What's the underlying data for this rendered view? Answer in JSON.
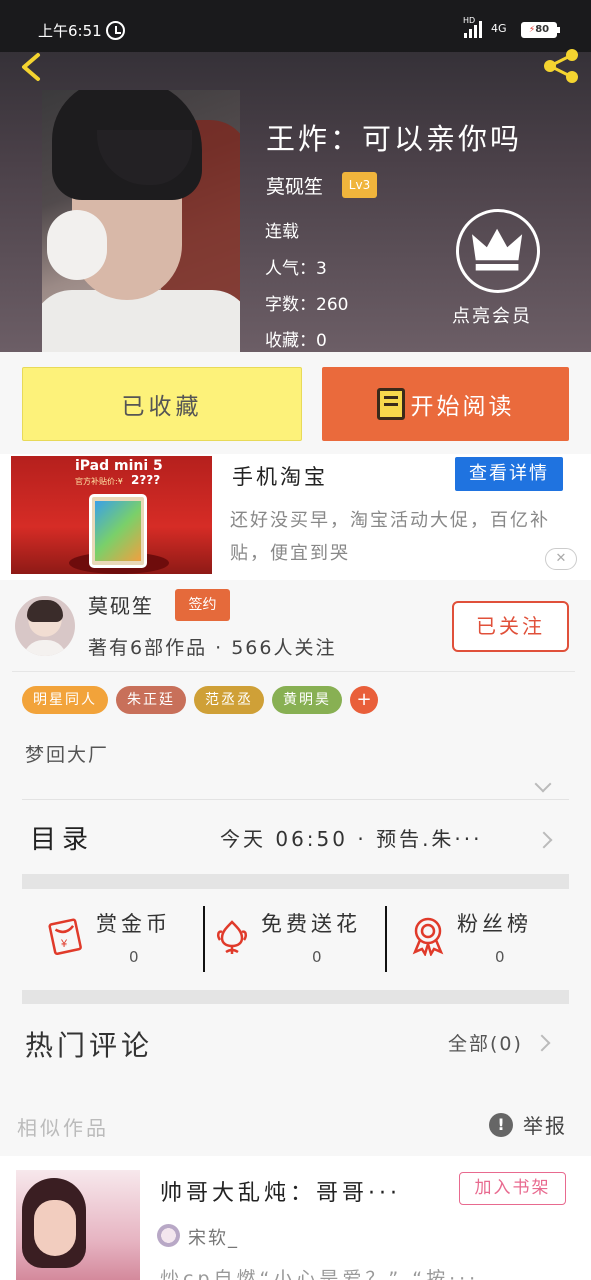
{
  "status_bar": {
    "time": "上午6:51",
    "network": "4G",
    "hd": "HD",
    "battery": "80"
  },
  "book": {
    "title": "王炸：可以亲你吗",
    "author": "莫砚笙",
    "level": "Lv3",
    "status": "连载",
    "popularity": "人气：3",
    "word_count": "字数：260",
    "favorites": "收藏：0",
    "vip_label": "点亮会员"
  },
  "actions": {
    "collected_label": "已收藏",
    "read_label": "开始阅读"
  },
  "ad": {
    "image_title": "iPad mini 5",
    "image_subtitle": "官方补贴价:¥",
    "image_price": "2???",
    "title": "手机淘宝",
    "detail_button": "查看详情",
    "description": "还好没买早，淘宝活动大促，百亿补贴，便宜到哭",
    "close_icon": "✕"
  },
  "author_card": {
    "name": "莫砚笙",
    "badge": "签约",
    "stats": "著有6部作品 · 566人关注",
    "follow_label": "已关注"
  },
  "tags": [
    {
      "label": "明星同人",
      "color": "#f2a33a"
    },
    {
      "label": "朱正廷",
      "color": "#c8705a"
    },
    {
      "label": "范丞丞",
      "color": "#cfa037"
    },
    {
      "label": "黄明昊",
      "color": "#88b053"
    }
  ],
  "tag_add": "+",
  "intro": "梦回大厂",
  "toc": {
    "title": "目录",
    "latest": "今天 06:50 · 预告.朱···"
  },
  "stats": [
    {
      "label": "赏金币",
      "value": "0",
      "icon": "red-envelope-icon"
    },
    {
      "label": "免费送花",
      "value": "0",
      "icon": "flower-icon"
    },
    {
      "label": "粉丝榜",
      "value": "0",
      "icon": "medal-icon"
    }
  ],
  "comments": {
    "title": "热门评论",
    "all_label": "全部(0)"
  },
  "similar": {
    "section_label": "相似作品",
    "report_label": "举报",
    "report_icon": "!",
    "item": {
      "title": "帅哥大乱炖：哥哥···",
      "add_label": "加入书架",
      "author": "宋软_",
      "desc": "炒cp自燃“小心是爱？” “按···"
    }
  },
  "colors": {
    "accent_orange": "#ea6a3c",
    "collected_yellow": "#fdf27a",
    "ad_blue": "#1f73e0",
    "follow_red": "#e0503a"
  }
}
